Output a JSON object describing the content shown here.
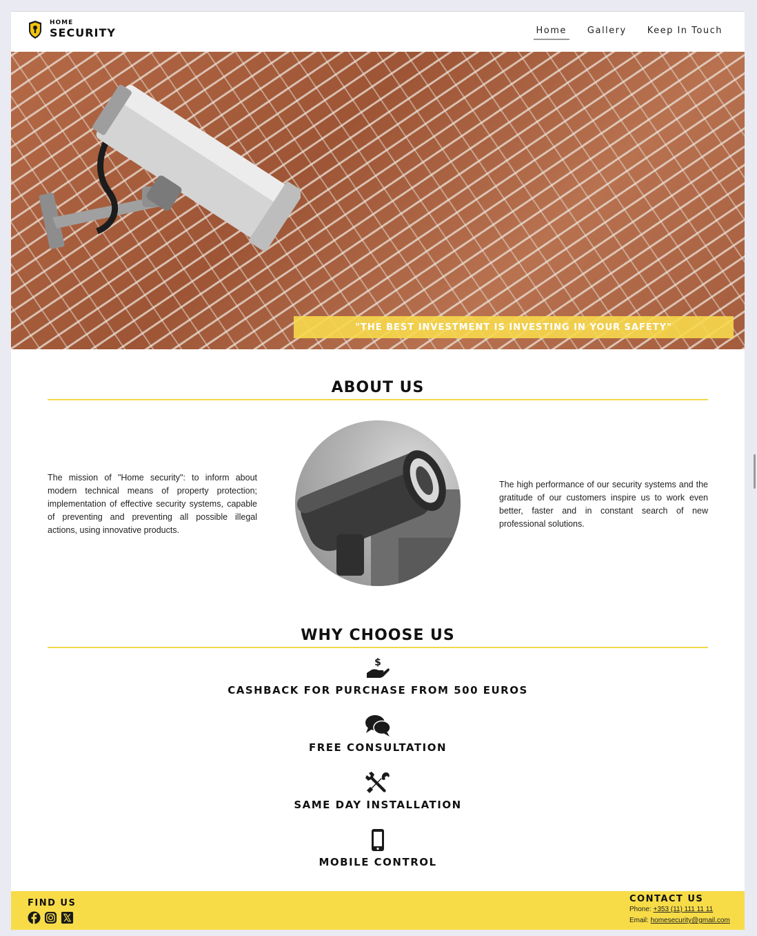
{
  "header": {
    "logo_small": "HOME",
    "logo_big": "SECURITY",
    "nav": [
      {
        "label": "Home",
        "active": true
      },
      {
        "label": "Gallery",
        "active": false
      },
      {
        "label": "Keep In Touch",
        "active": false
      }
    ]
  },
  "hero": {
    "banner": "\"THE BEST INVESTMENT IS INVESTING IN YOUR SAFETY\""
  },
  "about": {
    "title": "ABOUT US",
    "left_text": "The mission of \"Home security\": to inform about modern technical means of property protection; implementation of effective security systems, capable of preventing and preventing all possible illegal actions, using innovative products.",
    "right_text": "The high performance of our security systems and the gratitude of our customers inspire us to work even better, faster and in constant search of new professional solutions."
  },
  "why": {
    "title": "WHY CHOOSE US",
    "features": [
      {
        "icon": "hand-dollar-icon",
        "label": "CASHBACK FOR PURCHASE FROM 500 EUROS"
      },
      {
        "icon": "chat-bubbles-icon",
        "label": "FREE CONSULTATION"
      },
      {
        "icon": "tools-icon",
        "label": "SAME DAY INSTALLATION"
      },
      {
        "icon": "mobile-phone-icon",
        "label": "MOBILE CONTROL"
      }
    ]
  },
  "footer": {
    "find_us": "FIND US",
    "socials": [
      "facebook-icon",
      "instagram-icon",
      "x-icon"
    ],
    "contact_title": "CONTACT US",
    "phone_label": "Phone:",
    "phone": "+353 (11) 111 11 11",
    "email_label": "Email:",
    "email": "homesecurity@gmail.com"
  },
  "colors": {
    "accent_yellow": "#f7dc48",
    "text": "#111111"
  }
}
